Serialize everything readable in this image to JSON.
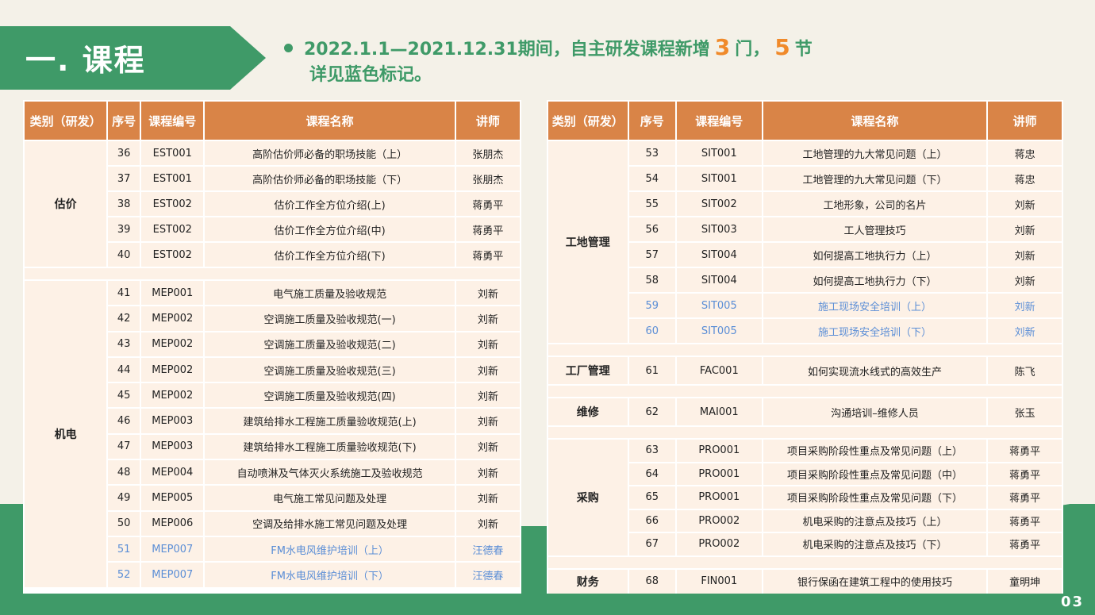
{
  "header": {
    "title": "一. 课程",
    "summary_line1_prefix": "2022.1.1—2021.12.31期间，自主研发课程新增",
    "course_count": "3",
    "unit_course": "门，",
    "lesson_count": "5",
    "unit_lesson": "节",
    "summary_line2": "详见蓝色标记。"
  },
  "table_headers": [
    "类别（研发）",
    "序号",
    "课程编号",
    "课程名称",
    "讲师"
  ],
  "left_table": {
    "groups": [
      {
        "category": "估价",
        "rows": [
          {
            "no": "36",
            "code": "EST001",
            "name": "高阶估价师必备的职场技能（上）",
            "lecturer": "张朋杰",
            "blue": false
          },
          {
            "no": "37",
            "code": "EST001",
            "name": "高阶估价师必备的职场技能（下）",
            "lecturer": "张朋杰",
            "blue": false
          },
          {
            "no": "38",
            "code": "EST002",
            "name": "估价工作全方位介绍(上)",
            "lecturer": "蒋勇平",
            "blue": false
          },
          {
            "no": "39",
            "code": "EST002",
            "name": "估价工作全方位介绍(中)",
            "lecturer": "蒋勇平",
            "blue": false
          },
          {
            "no": "40",
            "code": "EST002",
            "name": "估价工作全方位介绍(下)",
            "lecturer": "蒋勇平",
            "blue": false
          }
        ]
      },
      {
        "category": "机电",
        "rows": [
          {
            "no": "41",
            "code": "MEP001",
            "name": "电气施工质量及验收规范",
            "lecturer": "刘新",
            "blue": false
          },
          {
            "no": "42",
            "code": "MEP002",
            "name": "空调施工质量及验收规范(一)",
            "lecturer": "刘新",
            "blue": false
          },
          {
            "no": "43",
            "code": "MEP002",
            "name": "空调施工质量及验收规范(二)",
            "lecturer": "刘新",
            "blue": false
          },
          {
            "no": "44",
            "code": "MEP002",
            "name": "空调施工质量及验收规范(三)",
            "lecturer": "刘新",
            "blue": false
          },
          {
            "no": "45",
            "code": "MEP002",
            "name": "空调施工质量及验收规范(四)",
            "lecturer": "刘新",
            "blue": false
          },
          {
            "no": "46",
            "code": "MEP003",
            "name": "建筑给排水工程施工质量验收规范(上)",
            "lecturer": "刘新",
            "blue": false
          },
          {
            "no": "47",
            "code": "MEP003",
            "name": "建筑给排水工程施工质量验收规范(下)",
            "lecturer": "刘新",
            "blue": false
          },
          {
            "no": "48",
            "code": "MEP004",
            "name": "自动喷淋及气体灭火系统施工及验收规范",
            "lecturer": "刘新",
            "blue": false
          },
          {
            "no": "49",
            "code": "MEP005",
            "name": "电气施工常见问题及处理",
            "lecturer": "刘新",
            "blue": false
          },
          {
            "no": "50",
            "code": "MEP006",
            "name": "空调及给排水施工常见问题及处理",
            "lecturer": "刘新",
            "blue": false
          },
          {
            "no": "51",
            "code": "MEP007",
            "name": "FM水电风维护培训（上）",
            "lecturer": "汪德春",
            "blue": true
          },
          {
            "no": "52",
            "code": "MEP007",
            "name": "FM水电风维护培训（下）",
            "lecturer": "汪德春",
            "blue": true
          }
        ]
      }
    ]
  },
  "right_table": {
    "groups": [
      {
        "category": "工地管理",
        "rows": [
          {
            "no": "53",
            "code": "SIT001",
            "name": "工地管理的九大常见问题（上）",
            "lecturer": "蒋忠",
            "blue": false
          },
          {
            "no": "54",
            "code": "SIT001",
            "name": "工地管理的九大常见问题（下）",
            "lecturer": "蒋忠",
            "blue": false
          },
          {
            "no": "55",
            "code": "SIT002",
            "name": "工地形象，公司的名片",
            "lecturer": "刘新",
            "blue": false
          },
          {
            "no": "56",
            "code": "SIT003",
            "name": "工人管理技巧",
            "lecturer": "刘新",
            "blue": false
          },
          {
            "no": "57",
            "code": "SIT004",
            "name": "如何提高工地执行力（上）",
            "lecturer": "刘新",
            "blue": false
          },
          {
            "no": "58",
            "code": "SIT004",
            "name": "如何提高工地执行力（下）",
            "lecturer": "刘新",
            "blue": false
          },
          {
            "no": "59",
            "code": "SIT005",
            "name": "施工现场安全培训（上）",
            "lecturer": "刘新",
            "blue": true
          },
          {
            "no": "60",
            "code": "SIT005",
            "name": "施工现场安全培训（下）",
            "lecturer": "刘新",
            "blue": true
          }
        ]
      },
      {
        "category": "工厂管理",
        "rows": [
          {
            "no": "61",
            "code": "FAC001",
            "name": "如何实现流水线式的高效生产",
            "lecturer": "陈飞",
            "blue": false
          }
        ]
      },
      {
        "category": "维修",
        "rows": [
          {
            "no": "62",
            "code": "MAI001",
            "name": "沟通培训–维修人员",
            "lecturer": "张玉",
            "blue": false
          }
        ]
      },
      {
        "category": "采购",
        "rows": [
          {
            "no": "63",
            "code": "PRO001",
            "name": "项目采购阶段性重点及常见问题（上）",
            "lecturer": "蒋勇平",
            "blue": false
          },
          {
            "no": "64",
            "code": "PRO001",
            "name": "项目采购阶段性重点及常见问题（中）",
            "lecturer": "蒋勇平",
            "blue": false
          },
          {
            "no": "65",
            "code": "PRO001",
            "name": "项目采购阶段性重点及常见问题（下）",
            "lecturer": "蒋勇平",
            "blue": false
          },
          {
            "no": "66",
            "code": "PRO002",
            "name": "机电采购的注意点及技巧（上）",
            "lecturer": "蒋勇平",
            "blue": false
          },
          {
            "no": "67",
            "code": "PRO002",
            "name": "机电采购的注意点及技巧（下）",
            "lecturer": "蒋勇平",
            "blue": false
          }
        ]
      },
      {
        "category": "财务",
        "rows": [
          {
            "no": "68",
            "code": "FIN001",
            "name": "银行保函在建筑工程中的使用技巧",
            "lecturer": "童明坤",
            "blue": false
          }
        ]
      }
    ]
  },
  "page_number": "03",
  "colors": {
    "green": "#3f9a68",
    "header_orange": "#d98447",
    "cell_bg": "#fdf1e6",
    "highlight_blue": "#5b8ed6",
    "number_orange": "#f08a2a"
  }
}
